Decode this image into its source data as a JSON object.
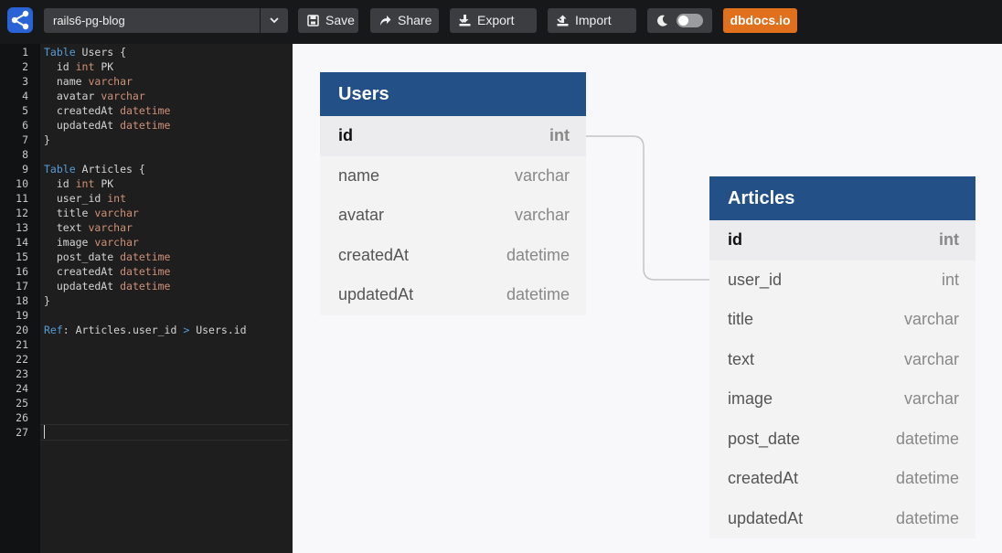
{
  "toolbar": {
    "project_name": "rails6-pg-blog",
    "save_label": "Save",
    "share_label": "Share",
    "export_label": "Export",
    "import_label": "Import",
    "dbdocs_label": "dbdocs.io",
    "theme_toggle_on": false
  },
  "editor": {
    "line_numbers": [
      "1",
      "2",
      "3",
      "4",
      "5",
      "6",
      "7",
      "8",
      "9",
      "10",
      "11",
      "12",
      "13",
      "14",
      "15",
      "16",
      "17",
      "18",
      "19",
      "20",
      "21",
      "22",
      "23",
      "24",
      "25",
      "26",
      "27"
    ],
    "cursor_line": "27"
  },
  "schema": {
    "users": {
      "name": "Users",
      "columns": [
        {
          "name": "id",
          "type": "int",
          "pk": true
        },
        {
          "name": "name",
          "type": "varchar"
        },
        {
          "name": "avatar",
          "type": "varchar"
        },
        {
          "name": "createdAt",
          "type": "datetime"
        },
        {
          "name": "updatedAt",
          "type": "datetime"
        }
      ]
    },
    "articles": {
      "name": "Articles",
      "columns": [
        {
          "name": "id",
          "type": "int",
          "pk": true
        },
        {
          "name": "user_id",
          "type": "int"
        },
        {
          "name": "title",
          "type": "varchar"
        },
        {
          "name": "text",
          "type": "varchar"
        },
        {
          "name": "image",
          "type": "varchar"
        },
        {
          "name": "post_date",
          "type": "datetime"
        },
        {
          "name": "createdAt",
          "type": "datetime"
        },
        {
          "name": "updatedAt",
          "type": "datetime"
        }
      ]
    },
    "ref": {
      "kw": "Ref",
      "from": "Articles.user_id",
      "op": ">",
      "to": "Users.id"
    }
  },
  "code_tokens": {
    "table_kw": "Table",
    "pk": "PK",
    "open_brace": "{",
    "close_brace": "}",
    "colon": ":"
  },
  "colors": {
    "header_blue": "#245088",
    "dbdocs_orange": "#e0701c",
    "keyword_blue": "#569cd6",
    "type_orange": "#ce9178"
  }
}
